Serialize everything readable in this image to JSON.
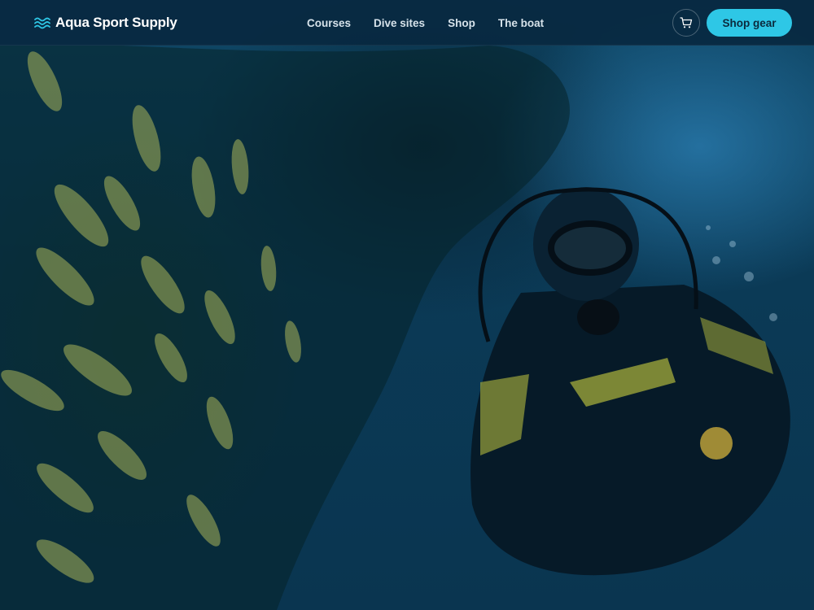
{
  "brand": {
    "name": "Aqua Sport Supply",
    "icon": "waves-icon"
  },
  "nav": {
    "items": [
      {
        "label": "Courses"
      },
      {
        "label": "Dive sites"
      },
      {
        "label": "Shop"
      },
      {
        "label": "The boat"
      }
    ]
  },
  "actions": {
    "cart_icon": "cart-icon",
    "shop_button_label": "Shop gear"
  },
  "colors": {
    "header_bg": "#082840",
    "accent": "#2ec7e6",
    "overlay": "#0b3a56"
  },
  "hero": {
    "image": "scuba diver beside a school of yellow-striped fish under a reef"
  }
}
